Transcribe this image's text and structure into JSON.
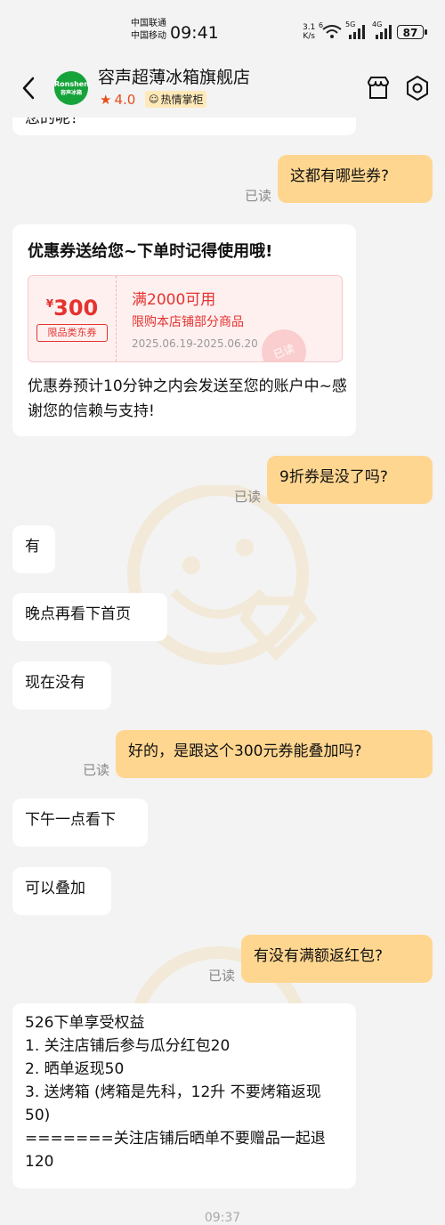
{
  "status": {
    "carrier1": "中国联通",
    "carrier2": "中国移动",
    "time": "09:41",
    "net_speed_value": "3.1",
    "net_speed_unit": "K/s",
    "sig1_label": "6",
    "sig2_label": "5G",
    "sig3_label": "4G",
    "battery": "87"
  },
  "header": {
    "logo_text": "Ronshen",
    "logo_sub": "容声冰箱",
    "title": "容声超薄冰箱旗舰店",
    "rating": "4.0",
    "badge": "热情掌柜"
  },
  "messages": {
    "cut_top": "您的呢！",
    "q1": "这都有哪些券?",
    "read": "已读",
    "coupon_title": "优惠券送给您~下单时记得使用哦!",
    "coupon": {
      "currency": "¥",
      "amount": "300",
      "tag": "限品类东券",
      "condition": "满2000可用",
      "scope": "限购本店铺部分商品",
      "date": "2025.06.19-2025.06.20",
      "stamp": "已读"
    },
    "coupon_note": "优惠券预计10分钟之内会发送至您的账户中~感谢您的信赖与支持!",
    "q2": "9折券是没了吗?",
    "a2a": "有",
    "a2b": "晚点再看下首页",
    "a2c": "现在没有",
    "q3": "好的，是跟这个300元券能叠加吗?",
    "a3a": "下午一点看下",
    "a3b": "可以叠加",
    "q4": "有没有满额返红包?",
    "benefit": [
      "526下单享受权益",
      "1. 关注店铺后参与瓜分红包20",
      "2. 晒单返现50",
      "3. 送烤箱 (烤箱是先科，12升 不要烤箱返现50)",
      "=======关注店铺后晒单不要赠品一起退120"
    ],
    "footer_time": "09:37"
  },
  "colors": {
    "accent": "#ffd690",
    "coupon_red": "#e4332f",
    "brand_green": "#16a33a"
  }
}
